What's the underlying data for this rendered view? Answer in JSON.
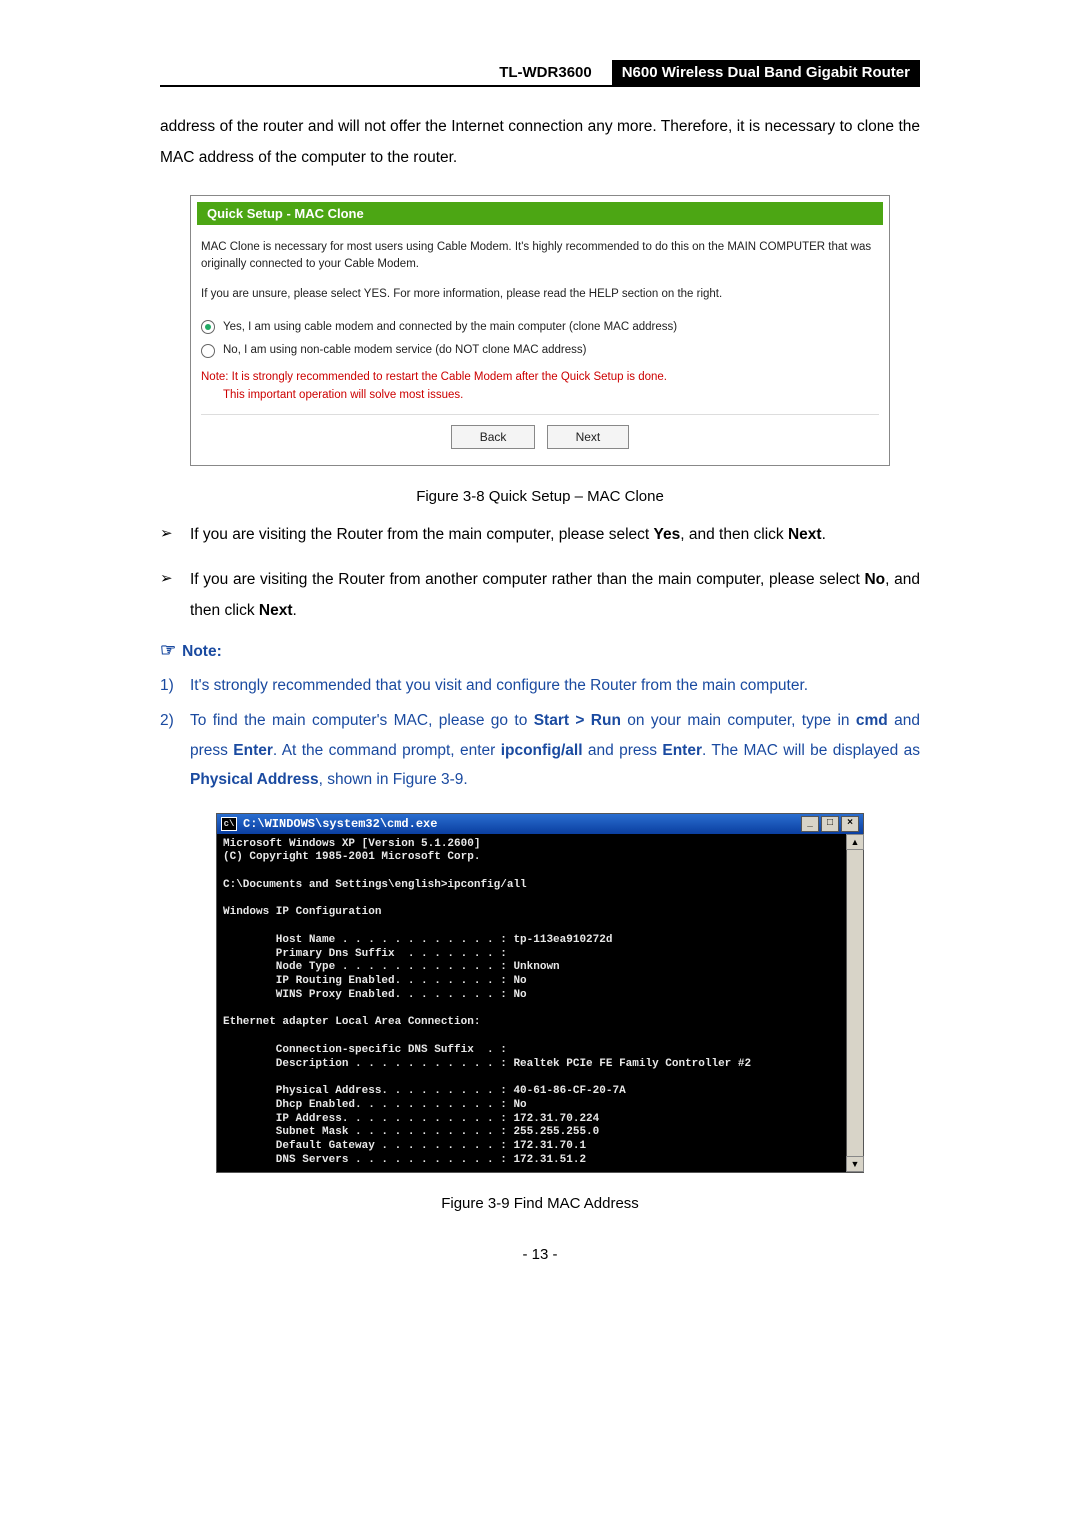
{
  "header": {
    "model": "TL-WDR3600",
    "desc": "N600 Wireless Dual Band Gigabit Router"
  },
  "intro_text": "address of the router and will not offer the Internet connection any more. Therefore, it is necessary to clone the MAC address of the computer to the router.",
  "fig1": {
    "title": "Quick Setup - MAC Clone",
    "para1": "MAC Clone is necessary for most users using Cable Modem. It's highly recommended to do this on the MAIN COMPUTER that was originally connected to your Cable Modem.",
    "para2": "If you are unsure, please select YES. For more information, please read the HELP section on the right.",
    "optYes": "Yes, I am using cable modem and connected by the main computer (clone MAC address)",
    "optNo": "No, I am using non-cable modem service (do NOT clone MAC address)",
    "noteLine1": "Note: It is strongly recommended to restart the Cable Modem after the Quick Setup is done.",
    "noteLine2": "This important operation will solve most issues.",
    "btnBack": "Back",
    "btnNext": "Next",
    "caption": "Figure 3-8 Quick Setup – MAC Clone"
  },
  "bullets": {
    "b1_a": "If you are visiting the Router from the main computer, please select ",
    "b1_yes": "Yes",
    "b1_b": ", and then click ",
    "b1_next": "Next",
    "b1_c": ".",
    "b2_a": "If you are visiting the Router from another computer rather than the main computer, please select ",
    "b2_no": "No",
    "b2_b": ", and then click ",
    "b2_next": "Next",
    "b2_c": "."
  },
  "note_heading": "Note:",
  "notes": {
    "n1": "It's strongly recommended that you visit and configure the Router from the main computer.",
    "n2_a": "To find the main computer's MAC, please go to ",
    "n2_startrun": "Start > Run",
    "n2_b": " on your main computer, type in ",
    "n2_cmd": "cmd",
    "n2_c": " and press ",
    "n2_enter": "Enter",
    "n2_d": ". At the command prompt, enter ",
    "n2_ipconfig": "ipconfig/all",
    "n2_e": " and press ",
    "n2_enter2": "Enter",
    "n2_f": ". The MAC will be displayed as ",
    "n2_phys": "Physical Address",
    "n2_g": ", shown in Figure 3-9."
  },
  "cmd": {
    "title": "C:\\WINDOWS\\system32\\cmd.exe",
    "body": "Microsoft Windows XP [Version 5.1.2600]\n(C) Copyright 1985-2001 Microsoft Corp.\n\nC:\\Documents and Settings\\english>ipconfig/all\n\nWindows IP Configuration\n\n        Host Name . . . . . . . . . . . . : tp-113ea910272d\n        Primary Dns Suffix  . . . . . . . :\n        Node Type . . . . . . . . . . . . : Unknown\n        IP Routing Enabled. . . . . . . . : No\n        WINS Proxy Enabled. . . . . . . . : No\n\nEthernet adapter Local Area Connection:\n\n        Connection-specific DNS Suffix  . :\n        Description . . . . . . . . . . . : Realtek PCIe FE Family Controller #2\n\n        Physical Address. . . . . . . . . : 40-61-86-CF-20-7A\n        Dhcp Enabled. . . . . . . . . . . : No\n        IP Address. . . . . . . . . . . . : 172.31.70.224\n        Subnet Mask . . . . . . . . . . . : 255.255.255.0\n        Default Gateway . . . . . . . . . : 172.31.70.1\n        DNS Servers . . . . . . . . . . . : 172.31.51.2",
    "caption": "Figure 3-9 Find MAC Address"
  },
  "page_number": "- 13 -"
}
